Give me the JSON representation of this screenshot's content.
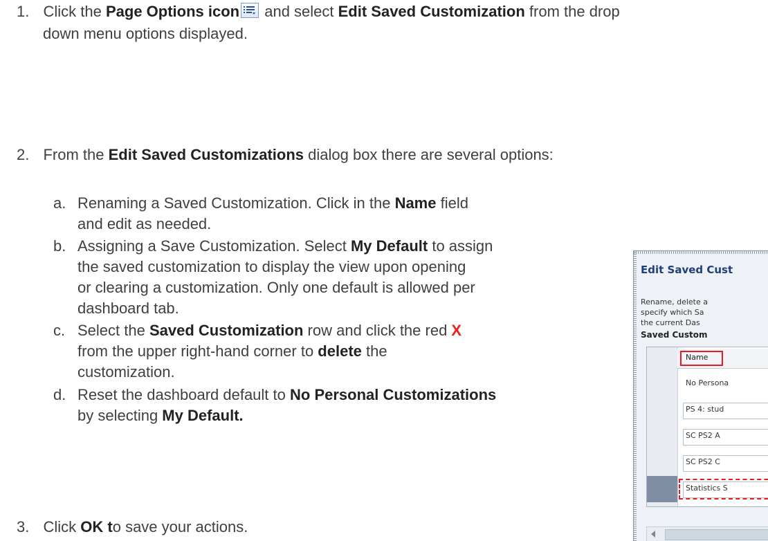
{
  "steps": {
    "s1": {
      "num": "1.",
      "a": "Click the ",
      "b": "Page Options icon",
      "c": " and select ",
      "d": "Edit Saved Customization",
      "e": " from the drop",
      "f": "down menu options displayed."
    },
    "s2": {
      "num": "2.",
      "a": "From the ",
      "b": "Edit Saved Customizations",
      "c": " dialog box there are several options:"
    },
    "s3": {
      "num": "3.",
      "a": "Click ",
      "b": "OK t",
      "c": "o save your actions."
    }
  },
  "subs": {
    "a": {
      "letter": "a.",
      "l1a": "Renaming a Saved Customization.  Click in the ",
      "l1b": "Name",
      "l1c": " field",
      "l2": "and edit as needed."
    },
    "b": {
      "letter": "b.",
      "l1a": "Assigning a Save Customization. Select ",
      "l1b": "My Default",
      "l1c": " to assign",
      "l2": "the saved customization to display the view upon opening",
      "l3": "or clearing a customization. Only one default is allowed per",
      "l4": "dashboard tab."
    },
    "c": {
      "letter": "c.",
      "l1a": "Select the ",
      "l1b": "Saved Customization",
      "l1c": " row and click the red ",
      "l1d": "X",
      "l2": "from the upper right-hand corner to ",
      "l2b": "delete",
      "l2c": " the",
      "l3": "customization."
    },
    "d": {
      "letter": "d.",
      "l1a": "Reset the dashboard default to ",
      "l1b": "No Personal Customizations",
      "l2a": "by selecting ",
      "l2b": "My Default."
    }
  },
  "dialog": {
    "title": "Edit Saved Cust",
    "desc1": "Rename, delete a",
    "desc2": "specify which Sa",
    "desc3": "the current Das",
    "section": "Saved Custom",
    "col_name": "Name",
    "rows": [
      "No Persona",
      "PS 4: stud",
      "SC PS2 A",
      "SC PS2 C",
      "Statistics S"
    ]
  },
  "colors": {
    "accent_red": "#e8211d",
    "dialog_title": "#1f3f77"
  }
}
